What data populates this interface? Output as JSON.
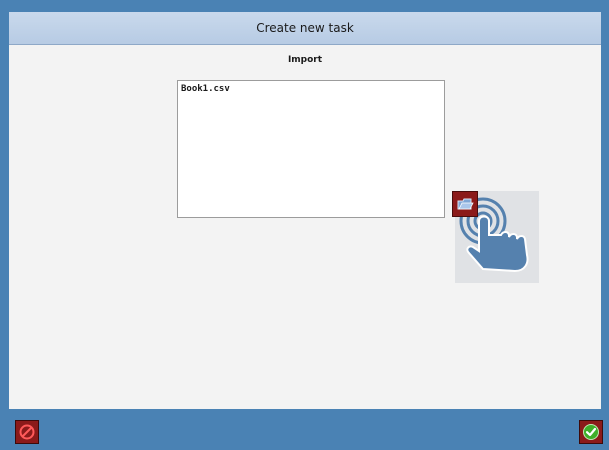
{
  "dialog": {
    "title": "Create new task",
    "section_label": "Import"
  },
  "file_list": {
    "items": [
      "Book1.csv"
    ]
  },
  "icons": {
    "browse": "folder-browse-icon",
    "touch_hint": "touch-hand-icon",
    "cancel": "cancel-icon",
    "confirm": "checkmark-icon"
  },
  "colors": {
    "frame": "#4a82b4",
    "title_bar": "#c3d5ea",
    "content_bg": "#f3f3f3",
    "button_red": "#8b1a1a",
    "ok_green": "#3fae2a"
  }
}
